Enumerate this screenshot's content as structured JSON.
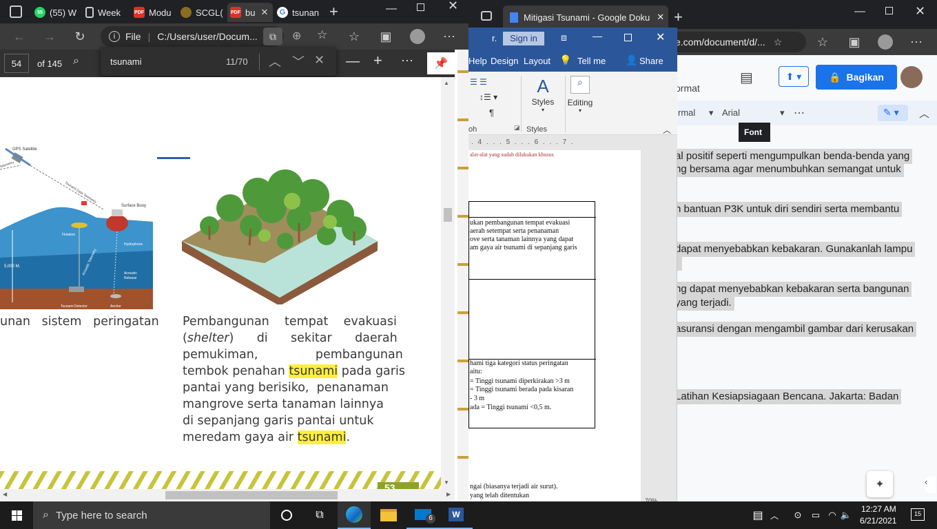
{
  "left_browser": {
    "tabs": [
      {
        "label": "(55) W",
        "icon": "whatsapp-icon",
        "color": "#25d366"
      },
      {
        "label": "Week",
        "icon": "document-icon",
        "color": "#9aa0a6"
      },
      {
        "label": "Modu",
        "icon": "pdf-icon",
        "color": "#d9342b"
      },
      {
        "label": "SCGL(",
        "icon": "university-icon",
        "color": "#c8a03a"
      },
      {
        "label": "bu",
        "icon": "pdf-icon",
        "color": "#d9342b"
      },
      {
        "label": "tsunan",
        "icon": "google-icon",
        "color": "#4285f4"
      }
    ],
    "address_prefix": "File",
    "address": "C:/Users/user/Docum...",
    "page_current": "54",
    "page_total": "of 145",
    "find_query": "tsunami",
    "find_count": "11/70"
  },
  "pdf": {
    "diagram_labels": {
      "satellite": "GPS Satellite",
      "telemetry1": "Telemetry",
      "telemetry2": "Tsunami Data Telemetry",
      "buoy": "Surface Buoy",
      "flotation": "Flotation",
      "hydrophone": "Hydrophone",
      "acoustic_telemetry": "Acoustic Telemetry",
      "acoustic_release": "Acoustic Release",
      "depth": "5,000 M.",
      "detector": "Tsunami Detector",
      "anchor": "Anchor"
    },
    "left_caption": "unan   sistem   peringatan",
    "caption_parts": {
      "l1": "Pembangunan    tempat    evakuasi",
      "l2a": "(",
      "l2b": "shelter",
      "l2c": ")      di      sekitar      daerah",
      "l3": "pemukiman,               pembangunan",
      "l4a": "tembok penahan ",
      "l4b": "tsunami",
      "l4c": " pada garis",
      "l5": "pantai yang berisiko,  penanaman",
      "l6": "mangrove serta tanaman lainnya",
      "l7": "di sepanjang garis pantai untuk",
      "l8a": "meredam gaya air ",
      "l8b": "tsunami",
      "l8c": "."
    },
    "page_number": "53"
  },
  "right_browser": {
    "tab_title": "Mitigasi Tsunami - Google Doku",
    "address": "e.com/document/d/...",
    "share_label": "Bagikan",
    "format_menu": "ormat",
    "style_dropdown": "rmal",
    "font_dropdown": "Arial",
    "font_tooltip": "Font",
    "doc_lines": [
      "al positif seperti mengumpulkan benda-benda yang",
      "ng bersama agar menumbuhkan semangat untuk",
      "n bantuan P3K untuk diri sendiri serta membantu",
      " dapat menyebabkan kebakaran. Gunakanlah lampu",
      "ng dapat menyebabkan kebakaran serta bangunan",
      "yang terjadi.",
      "asuransi dengan mengambil gambar dari kerusakan",
      " Latihan Kesiapsiagaan Bencana. Jakarta: Badan"
    ]
  },
  "word": {
    "menu_letter": "r.",
    "signin": "Sign in",
    "menu": [
      "Help",
      "Design",
      "Layout",
      "Tell me",
      "Share"
    ],
    "styles_label": "Styles",
    "editing_label": "Editing",
    "group_para": "oh",
    "group_styles": "Styles",
    "ruler": ". 4 . . . 5 . . . 6 . . . 7 .",
    "top_text": "alat-alat yang sudah dilakukan khusus",
    "cell1": [
      "ukan pembangunan tempat evakuasi",
      "aerah setempat serta penanaman",
      "ove serta tanaman lainnya yang dapat",
      "am gaya air tsunami di sepanjang garis"
    ],
    "cell3": [
      "hami tiga kategori status peringatan",
      "aitu:",
      "= Tinggi tsunami diperkirakan >3 m",
      "= Tinggi tsunami berada pada kisaran",
      "- 3 m",
      "ada = Tinggi tsunami <0,5 m."
    ],
    "bottom1": "ngai (biasanya terjadi air surut).",
    "bottom2": "yang telah ditentukan",
    "zoom": "70%"
  },
  "taskbar": {
    "search_placeholder": "Type here to search",
    "time": "12:27 AM",
    "date": "6/21/2021",
    "mail_badge": "6",
    "notif_badge": "15"
  }
}
